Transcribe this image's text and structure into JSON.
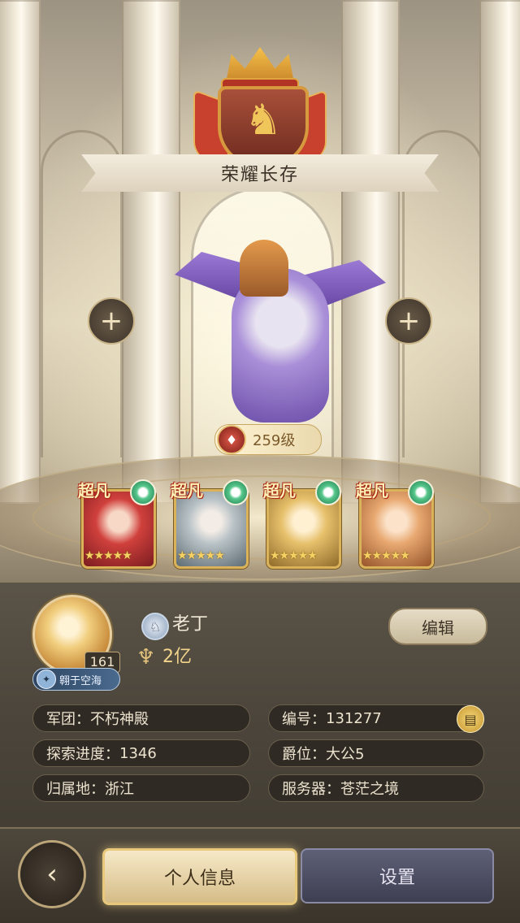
{
  "header": {
    "title": "荣耀长存"
  },
  "mount": {
    "level": "259级"
  },
  "side_buttons": {
    "add_left": "+",
    "add_right": "+"
  },
  "heroes": [
    {
      "grade": "超凡",
      "stars": "★★★★★",
      "element": "leaf-element"
    },
    {
      "grade": "超凡",
      "stars": "★★★★★",
      "element": "leaf-element"
    },
    {
      "grade": "超凡",
      "stars": "★★★★★",
      "element": "leaf-element"
    },
    {
      "grade": "超凡",
      "stars": "★★★★★",
      "element": "leaf-element"
    }
  ],
  "profile": {
    "avatar_level": "161",
    "title_badge": "翱于空海",
    "name": "老丁",
    "power": "2亿",
    "edit_label": "编辑"
  },
  "info": {
    "guild": {
      "key": "军团",
      "value": "不朽神殿"
    },
    "explore": {
      "key": "探索进度",
      "value": "1346"
    },
    "region": {
      "key": "归属地",
      "value": "浙江"
    },
    "id": {
      "key": "编号",
      "value": "131277"
    },
    "rank": {
      "key": "爵位",
      "value": "大公5"
    },
    "server": {
      "key": "服务器",
      "value": "苍茫之境"
    }
  },
  "tabs": {
    "profile_label": "个人信息",
    "settings_label": "设置"
  },
  "colors": {
    "accent": "#d9b25a",
    "panel": "#4b453b",
    "field": "#2f2a23"
  }
}
